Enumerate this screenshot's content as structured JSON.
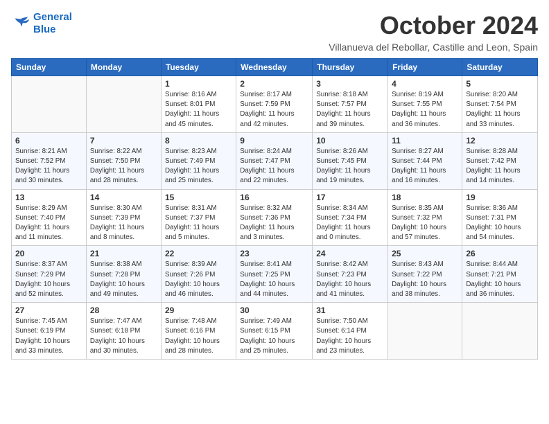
{
  "header": {
    "logo_line1": "General",
    "logo_line2": "Blue",
    "month": "October 2024",
    "location": "Villanueva del Rebollar, Castille and Leon, Spain"
  },
  "weekdays": [
    "Sunday",
    "Monday",
    "Tuesday",
    "Wednesday",
    "Thursday",
    "Friday",
    "Saturday"
  ],
  "weeks": [
    [
      {
        "day": "",
        "info": ""
      },
      {
        "day": "",
        "info": ""
      },
      {
        "day": "1",
        "info": "Sunrise: 8:16 AM\nSunset: 8:01 PM\nDaylight: 11 hours\nand 45 minutes."
      },
      {
        "day": "2",
        "info": "Sunrise: 8:17 AM\nSunset: 7:59 PM\nDaylight: 11 hours\nand 42 minutes."
      },
      {
        "day": "3",
        "info": "Sunrise: 8:18 AM\nSunset: 7:57 PM\nDaylight: 11 hours\nand 39 minutes."
      },
      {
        "day": "4",
        "info": "Sunrise: 8:19 AM\nSunset: 7:55 PM\nDaylight: 11 hours\nand 36 minutes."
      },
      {
        "day": "5",
        "info": "Sunrise: 8:20 AM\nSunset: 7:54 PM\nDaylight: 11 hours\nand 33 minutes."
      }
    ],
    [
      {
        "day": "6",
        "info": "Sunrise: 8:21 AM\nSunset: 7:52 PM\nDaylight: 11 hours\nand 30 minutes."
      },
      {
        "day": "7",
        "info": "Sunrise: 8:22 AM\nSunset: 7:50 PM\nDaylight: 11 hours\nand 28 minutes."
      },
      {
        "day": "8",
        "info": "Sunrise: 8:23 AM\nSunset: 7:49 PM\nDaylight: 11 hours\nand 25 minutes."
      },
      {
        "day": "9",
        "info": "Sunrise: 8:24 AM\nSunset: 7:47 PM\nDaylight: 11 hours\nand 22 minutes."
      },
      {
        "day": "10",
        "info": "Sunrise: 8:26 AM\nSunset: 7:45 PM\nDaylight: 11 hours\nand 19 minutes."
      },
      {
        "day": "11",
        "info": "Sunrise: 8:27 AM\nSunset: 7:44 PM\nDaylight: 11 hours\nand 16 minutes."
      },
      {
        "day": "12",
        "info": "Sunrise: 8:28 AM\nSunset: 7:42 PM\nDaylight: 11 hours\nand 14 minutes."
      }
    ],
    [
      {
        "day": "13",
        "info": "Sunrise: 8:29 AM\nSunset: 7:40 PM\nDaylight: 11 hours\nand 11 minutes."
      },
      {
        "day": "14",
        "info": "Sunrise: 8:30 AM\nSunset: 7:39 PM\nDaylight: 11 hours\nand 8 minutes."
      },
      {
        "day": "15",
        "info": "Sunrise: 8:31 AM\nSunset: 7:37 PM\nDaylight: 11 hours\nand 5 minutes."
      },
      {
        "day": "16",
        "info": "Sunrise: 8:32 AM\nSunset: 7:36 PM\nDaylight: 11 hours\nand 3 minutes."
      },
      {
        "day": "17",
        "info": "Sunrise: 8:34 AM\nSunset: 7:34 PM\nDaylight: 11 hours\nand 0 minutes."
      },
      {
        "day": "18",
        "info": "Sunrise: 8:35 AM\nSunset: 7:32 PM\nDaylight: 10 hours\nand 57 minutes."
      },
      {
        "day": "19",
        "info": "Sunrise: 8:36 AM\nSunset: 7:31 PM\nDaylight: 10 hours\nand 54 minutes."
      }
    ],
    [
      {
        "day": "20",
        "info": "Sunrise: 8:37 AM\nSunset: 7:29 PM\nDaylight: 10 hours\nand 52 minutes."
      },
      {
        "day": "21",
        "info": "Sunrise: 8:38 AM\nSunset: 7:28 PM\nDaylight: 10 hours\nand 49 minutes."
      },
      {
        "day": "22",
        "info": "Sunrise: 8:39 AM\nSunset: 7:26 PM\nDaylight: 10 hours\nand 46 minutes."
      },
      {
        "day": "23",
        "info": "Sunrise: 8:41 AM\nSunset: 7:25 PM\nDaylight: 10 hours\nand 44 minutes."
      },
      {
        "day": "24",
        "info": "Sunrise: 8:42 AM\nSunset: 7:23 PM\nDaylight: 10 hours\nand 41 minutes."
      },
      {
        "day": "25",
        "info": "Sunrise: 8:43 AM\nSunset: 7:22 PM\nDaylight: 10 hours\nand 38 minutes."
      },
      {
        "day": "26",
        "info": "Sunrise: 8:44 AM\nSunset: 7:21 PM\nDaylight: 10 hours\nand 36 minutes."
      }
    ],
    [
      {
        "day": "27",
        "info": "Sunrise: 7:45 AM\nSunset: 6:19 PM\nDaylight: 10 hours\nand 33 minutes."
      },
      {
        "day": "28",
        "info": "Sunrise: 7:47 AM\nSunset: 6:18 PM\nDaylight: 10 hours\nand 30 minutes."
      },
      {
        "day": "29",
        "info": "Sunrise: 7:48 AM\nSunset: 6:16 PM\nDaylight: 10 hours\nand 28 minutes."
      },
      {
        "day": "30",
        "info": "Sunrise: 7:49 AM\nSunset: 6:15 PM\nDaylight: 10 hours\nand 25 minutes."
      },
      {
        "day": "31",
        "info": "Sunrise: 7:50 AM\nSunset: 6:14 PM\nDaylight: 10 hours\nand 23 minutes."
      },
      {
        "day": "",
        "info": ""
      },
      {
        "day": "",
        "info": ""
      }
    ]
  ]
}
